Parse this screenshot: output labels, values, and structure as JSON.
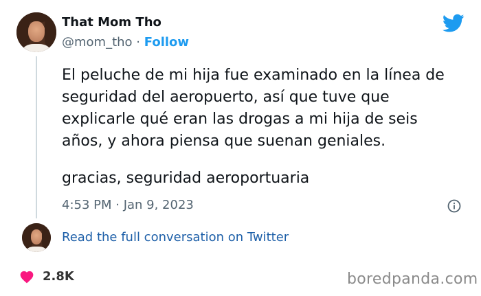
{
  "tweet": {
    "author_name": "That Mom Tho",
    "handle": "@mom_tho",
    "separator": "·",
    "follow_label": "Follow",
    "text_paragraph_1": "El peluche de mi hija fue examinado en la línea de seguridad del aeropuerto, así que tuve que explicarle qué eran las drogas a mi hija de seis años, y ahora piensa que suenan geniales.",
    "text_paragraph_2": "gracias, seguridad aeroportuaria",
    "timestamp": "4:53 PM · Jan 9, 2023",
    "read_more_label": "Read the full conversation on Twitter",
    "like_count": "2.8K"
  },
  "branding": {
    "watermark": "boredpanda.com"
  },
  "colors": {
    "twitter_blue": "#1d9bf0",
    "heart": "#f91880",
    "secondary_text": "#536471"
  },
  "icons": [
    "twitter-bird-icon",
    "info-icon",
    "heart-icon"
  ]
}
